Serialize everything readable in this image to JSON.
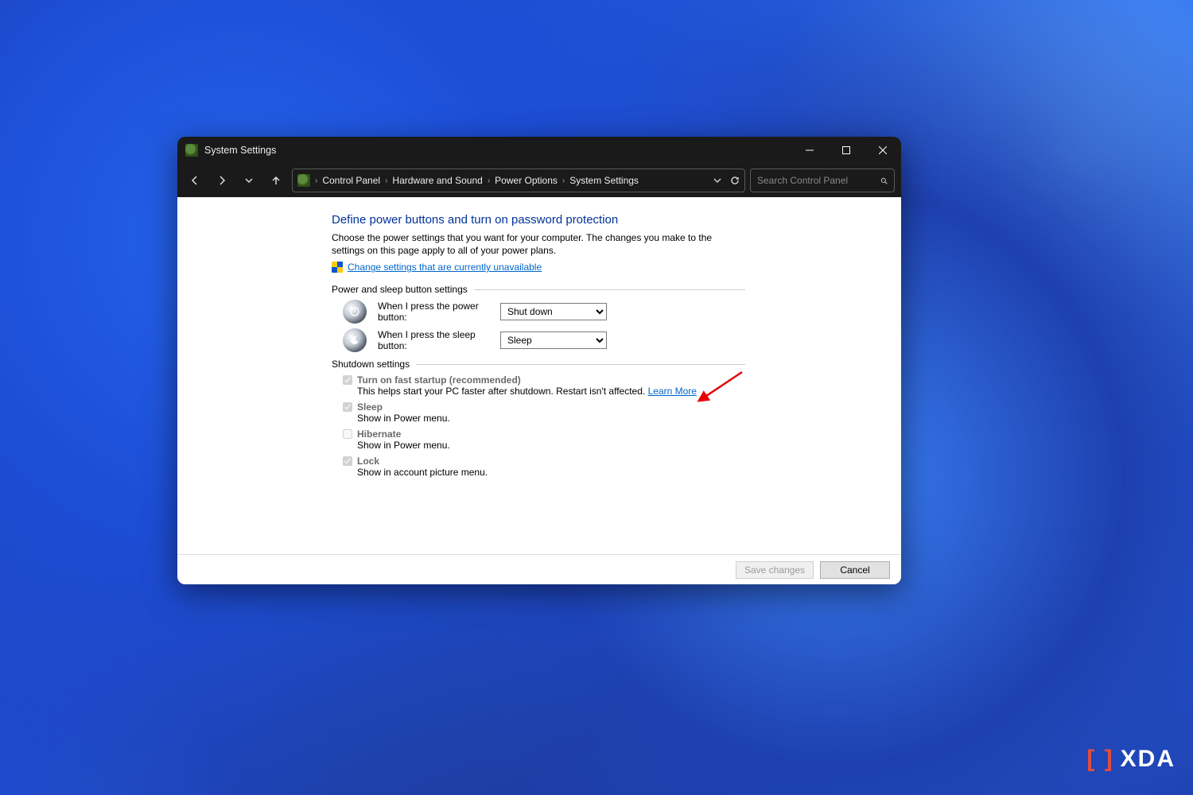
{
  "titlebar": {
    "title": "System Settings"
  },
  "nav": {
    "breadcrumb": [
      "Control Panel",
      "Hardware and Sound",
      "Power Options",
      "System Settings"
    ]
  },
  "search": {
    "placeholder": "Search Control Panel"
  },
  "page": {
    "heading": "Define power buttons and turn on password protection",
    "description": "Choose the power settings that you want for your computer. The changes you make to the settings on this page apply to all of your power plans.",
    "change_link": "Change settings that are currently unavailable",
    "group1_title": "Power and sleep button settings",
    "power_label": "When I press the power button:",
    "power_value": "Shut down",
    "sleep_label": "When I press the sleep button:",
    "sleep_value": "Sleep",
    "group2_title": "Shutdown settings",
    "fast_startup": {
      "label": "Turn on fast startup (recommended)",
      "sub": "This helps start your PC faster after shutdown. Restart isn't affected. ",
      "learn": "Learn More"
    },
    "sleep_opt": {
      "label": "Sleep",
      "sub": "Show in Power menu."
    },
    "hibernate_opt": {
      "label": "Hibernate",
      "sub": "Show in Power menu."
    },
    "lock_opt": {
      "label": "Lock",
      "sub": "Show in account picture menu."
    }
  },
  "footer": {
    "save": "Save changes",
    "cancel": "Cancel"
  },
  "watermark": "XDA"
}
